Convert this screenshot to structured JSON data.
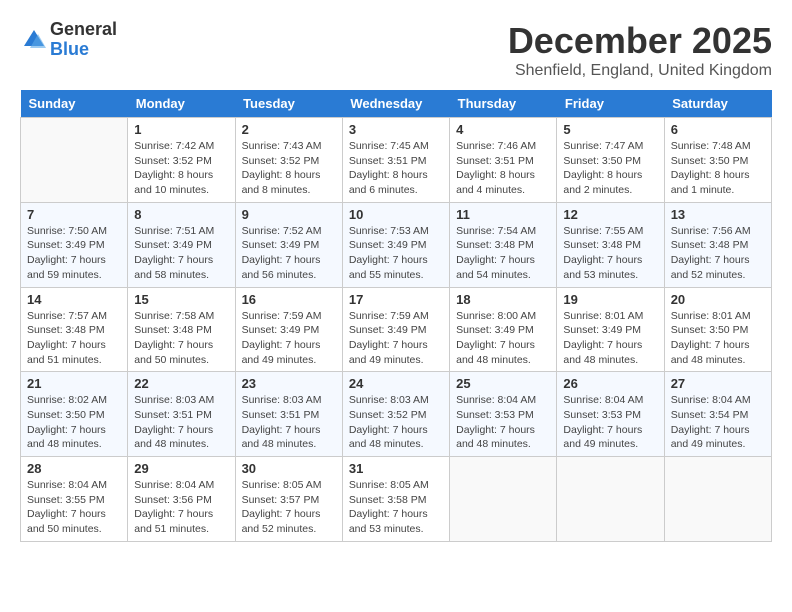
{
  "logo": {
    "general": "General",
    "blue": "Blue"
  },
  "title": "December 2025",
  "subtitle": "Shenfield, England, United Kingdom",
  "headers": [
    "Sunday",
    "Monday",
    "Tuesday",
    "Wednesday",
    "Thursday",
    "Friday",
    "Saturday"
  ],
  "weeks": [
    [
      {
        "date": "",
        "sunrise": "",
        "sunset": "",
        "daylight": ""
      },
      {
        "date": "1",
        "sunrise": "Sunrise: 7:42 AM",
        "sunset": "Sunset: 3:52 PM",
        "daylight": "Daylight: 8 hours and 10 minutes."
      },
      {
        "date": "2",
        "sunrise": "Sunrise: 7:43 AM",
        "sunset": "Sunset: 3:52 PM",
        "daylight": "Daylight: 8 hours and 8 minutes."
      },
      {
        "date": "3",
        "sunrise": "Sunrise: 7:45 AM",
        "sunset": "Sunset: 3:51 PM",
        "daylight": "Daylight: 8 hours and 6 minutes."
      },
      {
        "date": "4",
        "sunrise": "Sunrise: 7:46 AM",
        "sunset": "Sunset: 3:51 PM",
        "daylight": "Daylight: 8 hours and 4 minutes."
      },
      {
        "date": "5",
        "sunrise": "Sunrise: 7:47 AM",
        "sunset": "Sunset: 3:50 PM",
        "daylight": "Daylight: 8 hours and 2 minutes."
      },
      {
        "date": "6",
        "sunrise": "Sunrise: 7:48 AM",
        "sunset": "Sunset: 3:50 PM",
        "daylight": "Daylight: 8 hours and 1 minute."
      }
    ],
    [
      {
        "date": "7",
        "sunrise": "Sunrise: 7:50 AM",
        "sunset": "Sunset: 3:49 PM",
        "daylight": "Daylight: 7 hours and 59 minutes."
      },
      {
        "date": "8",
        "sunrise": "Sunrise: 7:51 AM",
        "sunset": "Sunset: 3:49 PM",
        "daylight": "Daylight: 7 hours and 58 minutes."
      },
      {
        "date": "9",
        "sunrise": "Sunrise: 7:52 AM",
        "sunset": "Sunset: 3:49 PM",
        "daylight": "Daylight: 7 hours and 56 minutes."
      },
      {
        "date": "10",
        "sunrise": "Sunrise: 7:53 AM",
        "sunset": "Sunset: 3:49 PM",
        "daylight": "Daylight: 7 hours and 55 minutes."
      },
      {
        "date": "11",
        "sunrise": "Sunrise: 7:54 AM",
        "sunset": "Sunset: 3:48 PM",
        "daylight": "Daylight: 7 hours and 54 minutes."
      },
      {
        "date": "12",
        "sunrise": "Sunrise: 7:55 AM",
        "sunset": "Sunset: 3:48 PM",
        "daylight": "Daylight: 7 hours and 53 minutes."
      },
      {
        "date": "13",
        "sunrise": "Sunrise: 7:56 AM",
        "sunset": "Sunset: 3:48 PM",
        "daylight": "Daylight: 7 hours and 52 minutes."
      }
    ],
    [
      {
        "date": "14",
        "sunrise": "Sunrise: 7:57 AM",
        "sunset": "Sunset: 3:48 PM",
        "daylight": "Daylight: 7 hours and 51 minutes."
      },
      {
        "date": "15",
        "sunrise": "Sunrise: 7:58 AM",
        "sunset": "Sunset: 3:48 PM",
        "daylight": "Daylight: 7 hours and 50 minutes."
      },
      {
        "date": "16",
        "sunrise": "Sunrise: 7:59 AM",
        "sunset": "Sunset: 3:49 PM",
        "daylight": "Daylight: 7 hours and 49 minutes."
      },
      {
        "date": "17",
        "sunrise": "Sunrise: 7:59 AM",
        "sunset": "Sunset: 3:49 PM",
        "daylight": "Daylight: 7 hours and 49 minutes."
      },
      {
        "date": "18",
        "sunrise": "Sunrise: 8:00 AM",
        "sunset": "Sunset: 3:49 PM",
        "daylight": "Daylight: 7 hours and 48 minutes."
      },
      {
        "date": "19",
        "sunrise": "Sunrise: 8:01 AM",
        "sunset": "Sunset: 3:49 PM",
        "daylight": "Daylight: 7 hours and 48 minutes."
      },
      {
        "date": "20",
        "sunrise": "Sunrise: 8:01 AM",
        "sunset": "Sunset: 3:50 PM",
        "daylight": "Daylight: 7 hours and 48 minutes."
      }
    ],
    [
      {
        "date": "21",
        "sunrise": "Sunrise: 8:02 AM",
        "sunset": "Sunset: 3:50 PM",
        "daylight": "Daylight: 7 hours and 48 minutes."
      },
      {
        "date": "22",
        "sunrise": "Sunrise: 8:03 AM",
        "sunset": "Sunset: 3:51 PM",
        "daylight": "Daylight: 7 hours and 48 minutes."
      },
      {
        "date": "23",
        "sunrise": "Sunrise: 8:03 AM",
        "sunset": "Sunset: 3:51 PM",
        "daylight": "Daylight: 7 hours and 48 minutes."
      },
      {
        "date": "24",
        "sunrise": "Sunrise: 8:03 AM",
        "sunset": "Sunset: 3:52 PM",
        "daylight": "Daylight: 7 hours and 48 minutes."
      },
      {
        "date": "25",
        "sunrise": "Sunrise: 8:04 AM",
        "sunset": "Sunset: 3:53 PM",
        "daylight": "Daylight: 7 hours and 48 minutes."
      },
      {
        "date": "26",
        "sunrise": "Sunrise: 8:04 AM",
        "sunset": "Sunset: 3:53 PM",
        "daylight": "Daylight: 7 hours and 49 minutes."
      },
      {
        "date": "27",
        "sunrise": "Sunrise: 8:04 AM",
        "sunset": "Sunset: 3:54 PM",
        "daylight": "Daylight: 7 hours and 49 minutes."
      }
    ],
    [
      {
        "date": "28",
        "sunrise": "Sunrise: 8:04 AM",
        "sunset": "Sunset: 3:55 PM",
        "daylight": "Daylight: 7 hours and 50 minutes."
      },
      {
        "date": "29",
        "sunrise": "Sunrise: 8:04 AM",
        "sunset": "Sunset: 3:56 PM",
        "daylight": "Daylight: 7 hours and 51 minutes."
      },
      {
        "date": "30",
        "sunrise": "Sunrise: 8:05 AM",
        "sunset": "Sunset: 3:57 PM",
        "daylight": "Daylight: 7 hours and 52 minutes."
      },
      {
        "date": "31",
        "sunrise": "Sunrise: 8:05 AM",
        "sunset": "Sunset: 3:58 PM",
        "daylight": "Daylight: 7 hours and 53 minutes."
      },
      {
        "date": "",
        "sunrise": "",
        "sunset": "",
        "daylight": ""
      },
      {
        "date": "",
        "sunrise": "",
        "sunset": "",
        "daylight": ""
      },
      {
        "date": "",
        "sunrise": "",
        "sunset": "",
        "daylight": ""
      }
    ]
  ]
}
